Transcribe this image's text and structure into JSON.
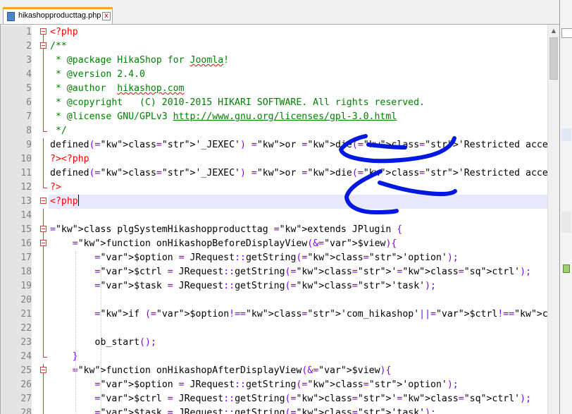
{
  "tab": {
    "label": "hikashopproducttag.php",
    "close_label": "x"
  },
  "lines": [
    {
      "n": "1",
      "t": "<?php"
    },
    {
      "n": "2",
      "t": "/**"
    },
    {
      "n": "3",
      "t": " * @package HikaShop for Joomla!"
    },
    {
      "n": "4",
      "t": " * @version 2.4.0"
    },
    {
      "n": "5",
      "t": " * @author  hikashop.com"
    },
    {
      "n": "6",
      "t": " * @copyright   (C) 2010-2015 HIKARI SOFTWARE. All rights reserved."
    },
    {
      "n": "7",
      "t": " * @license GNU/GPLv3 http://www.gnu.org/licenses/gpl-3.0.html"
    },
    {
      "n": "8",
      "t": " */"
    },
    {
      "n": "9",
      "t": "defined('_JEXEC') or die('Restricted access');"
    },
    {
      "n": "10",
      "t": "?><?php"
    },
    {
      "n": "11",
      "t": "defined('_JEXEC') or die('Restricted access');"
    },
    {
      "n": "12",
      "t": "?>"
    },
    {
      "n": "13",
      "t": "<?php"
    },
    {
      "n": "14",
      "t": ""
    },
    {
      "n": "15",
      "t": "class plgSystemHikashopproducttag extends JPlugin {"
    },
    {
      "n": "16",
      "t": "    function onHikashopBeforeDisplayView(&$view){"
    },
    {
      "n": "17",
      "t": "        $option = JRequest::getString('option');"
    },
    {
      "n": "18",
      "t": "        $ctrl = JRequest::getString('ctrl');"
    },
    {
      "n": "19",
      "t": "        $task = JRequest::getString('task');"
    },
    {
      "n": "20",
      "t": ""
    },
    {
      "n": "21",
      "t": "        if ($option!='com_hikashop'||$ctrl!='product'||$task!='show') return;"
    },
    {
      "n": "22",
      "t": ""
    },
    {
      "n": "23",
      "t": "        ob_start();"
    },
    {
      "n": "24",
      "t": "    }"
    },
    {
      "n": "25",
      "t": "    function onHikashopAfterDisplayView(&$view){"
    },
    {
      "n": "26",
      "t": "        $option = JRequest::getString('option');"
    },
    {
      "n": "27",
      "t": "        $ctrl = JRequest::getString('ctrl');"
    },
    {
      "n": "28",
      "t": "        $task = JRequest::getString('task');"
    }
  ],
  "colors": {
    "keyword": "#000080",
    "string": "#808080",
    "comment": "#008000",
    "php_tag": "#ff0000",
    "ink": "#0018e0",
    "current_line": "#e8e8ff"
  }
}
